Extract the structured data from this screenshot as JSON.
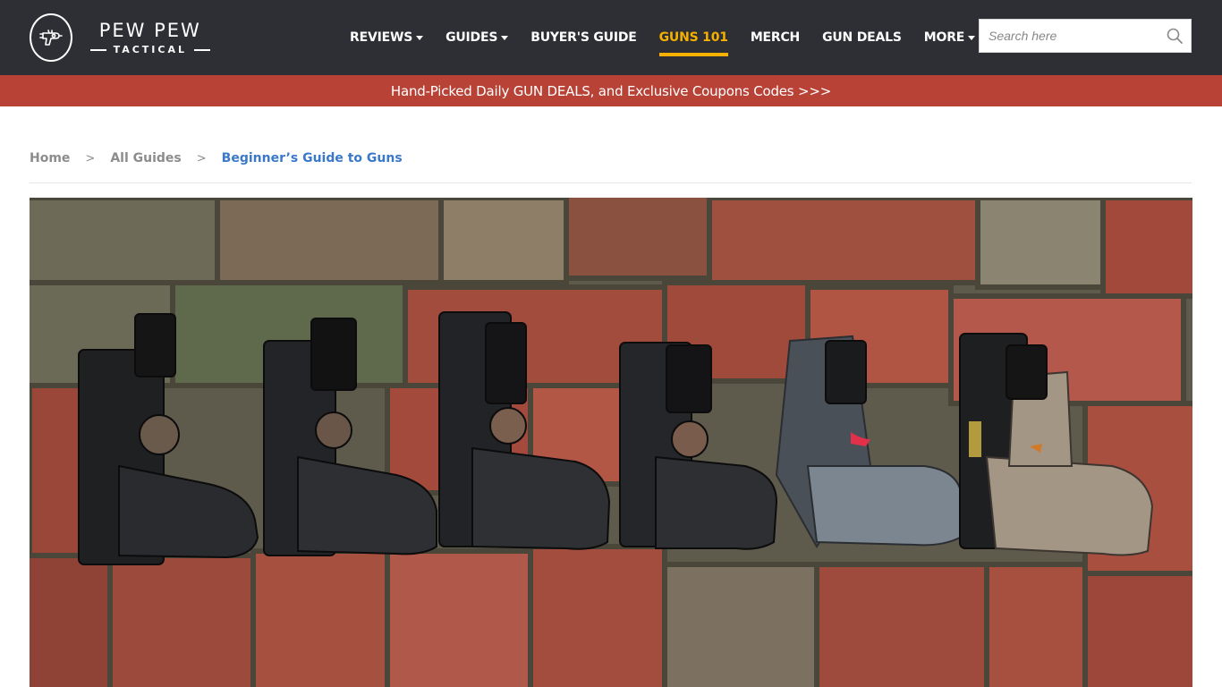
{
  "header": {
    "logo": {
      "title": "PEW PEW",
      "subtitle": "TACTICAL",
      "icon": "raygun-icon"
    },
    "nav": [
      {
        "label": "REVIEWS",
        "dropdown": true,
        "active": false
      },
      {
        "label": "GUIDES",
        "dropdown": true,
        "active": false
      },
      {
        "label": "BUYER'S GUIDE",
        "dropdown": false,
        "active": false
      },
      {
        "label": "GUNS 101",
        "dropdown": false,
        "active": true
      },
      {
        "label": "MERCH",
        "dropdown": false,
        "active": false
      },
      {
        "label": "GUN DEALS",
        "dropdown": false,
        "active": false
      },
      {
        "label": "MORE",
        "dropdown": true,
        "active": false
      }
    ],
    "search": {
      "placeholder": "Search here",
      "value": "",
      "icon": "search-icon"
    }
  },
  "promo": {
    "text": "Hand-Picked Daily GUN DEALS, and Exclusive Coupons Codes >>>"
  },
  "breadcrumb": {
    "items": [
      "Home",
      "All Guides",
      "Beginner’s Guide to Guns"
    ],
    "separator": ">"
  },
  "hero": {
    "subject": "six-pistols-on-brick-photo"
  },
  "colors": {
    "header_bg": "#2e2f34",
    "accent": "#f5b000",
    "promo_bg": "#b94237",
    "breadcrumb_current": "#3a78c9",
    "breadcrumb_muted": "#8c8c8c"
  }
}
